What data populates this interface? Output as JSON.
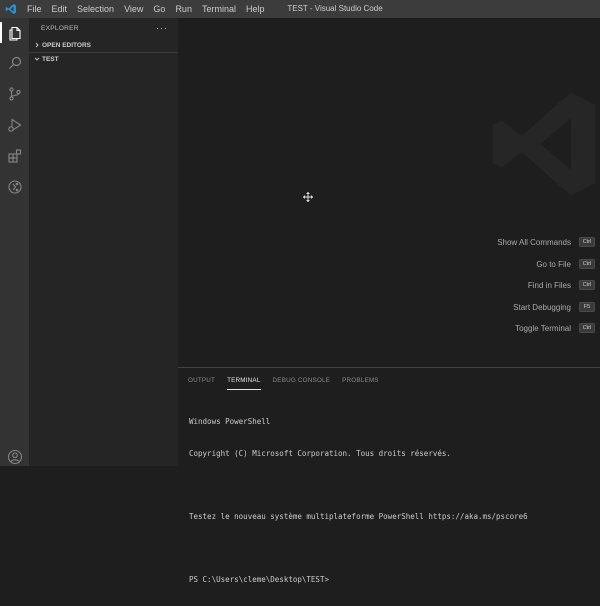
{
  "titlebar": {
    "menu": [
      "File",
      "Edit",
      "Selection",
      "View",
      "Go",
      "Run",
      "Terminal",
      "Help"
    ],
    "window_title": "TEST - Visual Studio Code"
  },
  "activitybar": {
    "icons": [
      "explorer-icon",
      "search-icon",
      "source-control-icon",
      "run-debug-icon",
      "extensions-icon",
      "remote-icon",
      "account-icon"
    ]
  },
  "sidebar": {
    "header": "EXPLORER",
    "more": "···",
    "sections": [
      {
        "label": "OPEN EDITORS",
        "expanded": false
      },
      {
        "label": "TEST",
        "expanded": true
      }
    ]
  },
  "editor": {
    "shortcuts": [
      {
        "label": "Show All Commands",
        "key": "Ctrl"
      },
      {
        "label": "Go to File",
        "key": "Ctrl"
      },
      {
        "label": "Find in Files",
        "key": "Ctrl"
      },
      {
        "label": "Start Debugging",
        "key": "F5"
      },
      {
        "label": "Toggle Terminal",
        "key": "Ctrl"
      }
    ]
  },
  "panel": {
    "tabs": [
      "OUTPUT",
      "TERMINAL",
      "DEBUG CONSOLE",
      "PROBLEMS"
    ],
    "active_tab": "TERMINAL",
    "terminal_lines": [
      "Windows PowerShell",
      "Copyright (C) Microsoft Corporation. Tous droits réservés.",
      "",
      "Testez le nouveau système multiplateforme PowerShell https://aka.ms/pscore6",
      "",
      "PS C:\\Users\\cleme\\Desktop\\TEST>"
    ]
  },
  "colors": {
    "accent": "#007acc",
    "titlebar_bg": "#3c3c3c",
    "activitybar_bg": "#333333",
    "sidebar_bg": "#252526",
    "editor_bg": "#1e1e1e"
  }
}
